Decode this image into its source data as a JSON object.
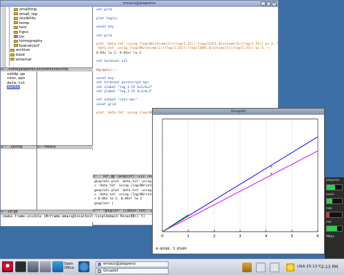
{
  "emacs": {
    "title": "emacs@jalapeno",
    "tree": [
      "smalltmp",
      "small_rep",
      "students",
      "temp",
      "test",
      "tigcs",
      "tm",
      "tomography",
      "tpanalconf",
      "archive",
      "base",
      "external"
    ],
    "tree_modeline": "U:-- /home/jalapeno/Documents/test/tmp",
    "files_left": [
      "subdp.pp",
      "conv.eps",
      "data.txt",
      "sorts"
    ],
    "files_left_modeline": "U:-- ...ve/tmp",
    "files_right_modeline": "U:-- History",
    "lower_modeline": "U:-- sor.gp",
    "editor_lines": [
      {
        "t": "set grid",
        "c": "kw"
      },
      {
        "t": "",
        "c": ""
      },
      {
        "t": "plot log(x)",
        "c": "kw"
      },
      {
        "t": "",
        "c": ""
      },
      {
        "t": "unset key",
        "c": "kw"
      },
      {
        "t": "",
        "c": ""
      },
      {
        "t": "set grid",
        "c": "kw"
      },
      {
        "t": "",
        "c": ""
      },
      {
        "t": "plot 'data.txt' using (log(80/column(1))/log(1.25)):(log(13371.0/column(2))/log(1.25)) ps 3, \\",
        "c": "mix"
      },
      {
        "t": "     'data.txt' using (log(80/column(1))/log(1.25)):(log(11091.0/column(3))/log(1.25)) ps 3, \\",
        "c": "mix"
      },
      {
        "t": "     0.84x lw 2, 0.84x+ lw 2",
        "c": "plain"
      },
      {
        "t": "",
        "c": ""
      },
      {
        "t": "set terminal x11",
        "c": "kw"
      },
      {
        "t": "",
        "c": ""
      },
      {
        "t": "#graphic:::",
        "c": "cmt"
      },
      {
        "t": "",
        "c": ""
      },
      {
        "t": "unset key",
        "c": "kw"
      },
      {
        "t": "set terminal postscript eps",
        "c": "kw"
      },
      {
        "t": "set xlabel \"log_1.25 d=1/d=2\"",
        "c": "kw"
      },
      {
        "t": "set ylabel \"log_1.25 d=1/d=2\"",
        "c": "kw"
      },
      {
        "t": "",
        "c": ""
      },
      {
        "t": "set output \"conv.eps\"",
        "c": "kw"
      },
      {
        "t": "unset grid",
        "c": "kw"
      },
      {
        "t": "",
        "c": ""
      },
      {
        "t": "plot 'data.txt' using (log(80/column(1))/log(1.25)):(log(13371.0/column(2))/log(1.25)) ps 3, \\",
        "c": "mix"
      }
    ],
    "editor_modeline": "U:-- sor.gp         (Gnuplot)--L11--All-------------------------------------------------",
    "gp_lines": [
      "gnuplot> plot 'data.txt' using (log(80/column(1))/log(1.25)):(log(13371.0/column(2))/log(1.25))~",
      ">         'data.txt' using (log(80/column(1))/log(1.25)):(log(11091.0/column(3))/log(1.25)) ps 3,~",
      "gnuplot> plot 'data.txt' using (log(80/column(1))/log(1.25)):(log(13371.0/column(2))/log(1.25))~",
      ">         'data.txt' using (log(80/column(1))/log(1.25)):(log(11091.0/column(3))/log(1.25)) ps 3,~",
      ">         0.84x lw 2, 0.84x+ lw 2",
      "gnuplot> |"
    ],
    "gp_modeline": "U:** *gnuplot*          (Comint:run)--L40--Bot------------------------------------------------",
    "minibuffer": "(make-frame-visible (#<frame emacs@localhost.localdomain 0xcac88>) t)"
  },
  "gnuplot": {
    "title": "Gnuplot",
    "status": "-0.00208, 5.05489",
    "xticks": [
      "0",
      "1",
      "2",
      "3",
      "4",
      "5",
      "6"
    ]
  },
  "chart_data": {
    "type": "line",
    "xlim": [
      0,
      6
    ],
    "ylim": [
      0,
      6
    ],
    "grid": true,
    "series": [
      {
        "color": "#0000ff",
        "x": [
          0,
          6
        ],
        "y": [
          0,
          5.05
        ]
      },
      {
        "color": "#e000e0",
        "x": [
          0,
          6
        ],
        "y": [
          0,
          4.3
        ]
      },
      {
        "color": "#00a000",
        "x": [
          0,
          1
        ],
        "y": [
          0,
          0.9
        ]
      }
    ],
    "xticks": [
      0,
      1,
      2,
      3,
      4,
      5,
      6
    ]
  },
  "dock": {
    "labels": [
      "jalapeno",
      "mem",
      "swp",
      "net",
      "Mbps"
    ],
    "meters": [
      {
        "level": 0.55,
        "kind": "green"
      },
      {
        "level": 0.35,
        "kind": "green"
      },
      {
        "level": 0.2,
        "kind": "red"
      },
      {
        "level": 0.7,
        "kind": "green"
      }
    ]
  },
  "taskbar": {
    "tasks": [
      "emacs@jalapeno",
      "Gnuplot"
    ],
    "launchers": [
      "start-menu",
      "terminal",
      "shell",
      "emacs",
      "openoffice",
      "web-browser"
    ],
    "openoffice_label": "Open Office",
    "temp": "USA 25-11°C",
    "clock": "2:13 PM"
  },
  "colors": {
    "desktop": "#3a6ea5",
    "blue_line": "#0000ff",
    "magenta_line": "#e000e0",
    "green_line": "#00a000"
  }
}
